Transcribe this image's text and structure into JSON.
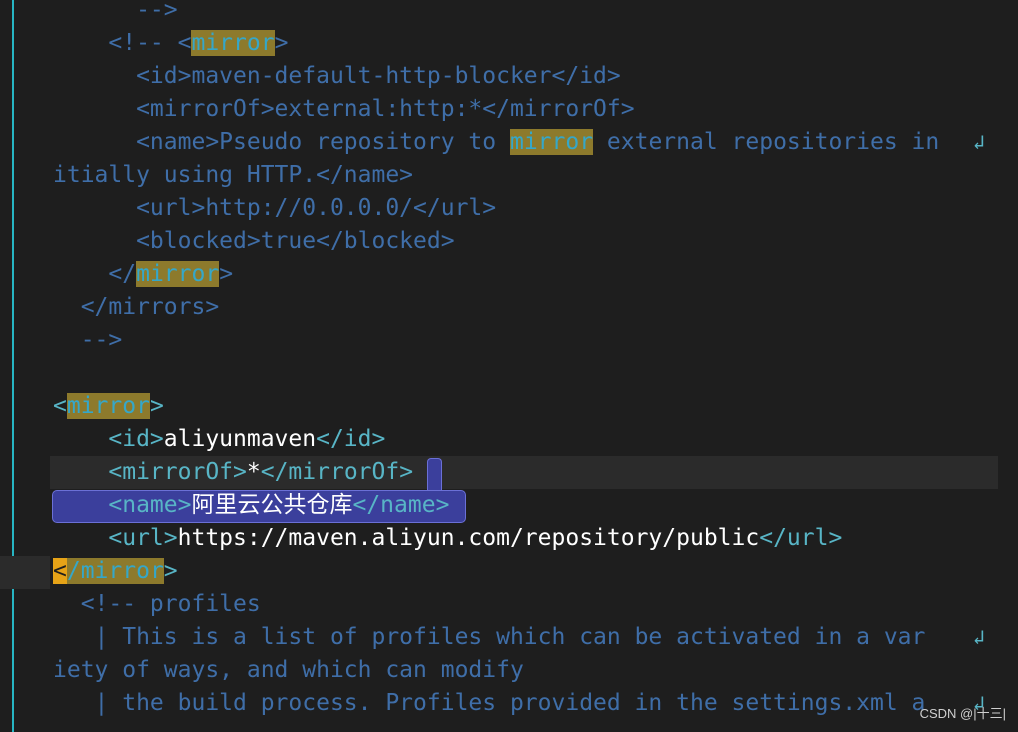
{
  "editor": {
    "lines": [
      {
        "segs": [
          {
            "c": "cmt",
            "t": "      -->"
          }
        ]
      },
      {
        "segs": [
          {
            "c": "cmt",
            "t": "    <!-- <"
          },
          {
            "c": "hl",
            "t": "mirror"
          },
          {
            "c": "cmt",
            "t": ">"
          }
        ]
      },
      {
        "segs": [
          {
            "c": "cmt",
            "t": "      <id>maven-default-http-blocker</id>"
          }
        ]
      },
      {
        "segs": [
          {
            "c": "cmt",
            "t": "      <mirrorOf>external:http:*</mirrorOf>"
          }
        ]
      },
      {
        "segs": [
          {
            "c": "cmt",
            "t": "      <name>Pseudo repository to "
          },
          {
            "c": "hl",
            "t": "mirror"
          },
          {
            "c": "cmt",
            "t": " external repositories in"
          }
        ],
        "wrap": true
      },
      {
        "segs": [
          {
            "c": "cmt",
            "t": "itially using HTTP.</name>"
          }
        ]
      },
      {
        "segs": [
          {
            "c": "cmt",
            "t": "      <url>http://0.0.0.0/</url>"
          }
        ]
      },
      {
        "segs": [
          {
            "c": "cmt",
            "t": "      <blocked>true</blocked>"
          }
        ]
      },
      {
        "segs": [
          {
            "c": "cmt",
            "t": "    </"
          },
          {
            "c": "hl",
            "t": "mirror"
          },
          {
            "c": "cmt",
            "t": ">"
          }
        ]
      },
      {
        "segs": [
          {
            "c": "cmt",
            "t": "  </mirrors>"
          }
        ]
      },
      {
        "segs": [
          {
            "c": "cmt",
            "t": "  -->"
          }
        ]
      },
      {
        "segs": [
          {
            "c": "cmt",
            "t": ""
          }
        ]
      },
      {
        "segs": [
          {
            "c": "tag",
            "t": "<"
          },
          {
            "c": "hl",
            "t": "mirror"
          },
          {
            "c": "tag",
            "t": ">"
          }
        ]
      },
      {
        "segs": [
          {
            "c": "tag",
            "t": "    <id>"
          },
          {
            "c": "val",
            "t": "aliyunmaven"
          },
          {
            "c": "tag",
            "t": "</id>"
          }
        ]
      },
      {
        "segs": [
          {
            "c": "tag",
            "t": "    <mirrorOf>"
          },
          {
            "c": "val",
            "t": "*"
          },
          {
            "c": "tag",
            "t": "</mirrorOf>"
          }
        ]
      },
      {
        "segs": [
          {
            "c": "tag",
            "t": "    <name>"
          },
          {
            "c": "val",
            "t": "阿里云公共仓库"
          },
          {
            "c": "tag",
            "t": "</name>"
          }
        ]
      },
      {
        "segs": [
          {
            "c": "tag",
            "t": "    <url>"
          },
          {
            "c": "val",
            "t": "https://maven.aliyun.com/repository/public"
          },
          {
            "c": "tag",
            "t": "</url>"
          }
        ]
      },
      {
        "segs": [
          {
            "c": "cur",
            "t": "<"
          },
          {
            "c": "hl",
            "t": "/mirror"
          },
          {
            "c": "tag",
            "t": ">"
          }
        ]
      },
      {
        "segs": [
          {
            "c": "cmt",
            "t": "  <!-- profiles"
          }
        ]
      },
      {
        "segs": [
          {
            "c": "cmt",
            "t": "   | This is a list of profiles which can be activated in a var "
          }
        ],
        "wrap": true
      },
      {
        "segs": [
          {
            "c": "cmt",
            "t": "iety of ways, and which can modify"
          }
        ]
      },
      {
        "segs": [
          {
            "c": "cmt",
            "t": "   | the build process. Profiles provided in the settings.xml a "
          }
        ],
        "wrap": true
      }
    ],
    "wrap_glyph": "↲"
  },
  "watermark": "CSDN @|十三|"
}
